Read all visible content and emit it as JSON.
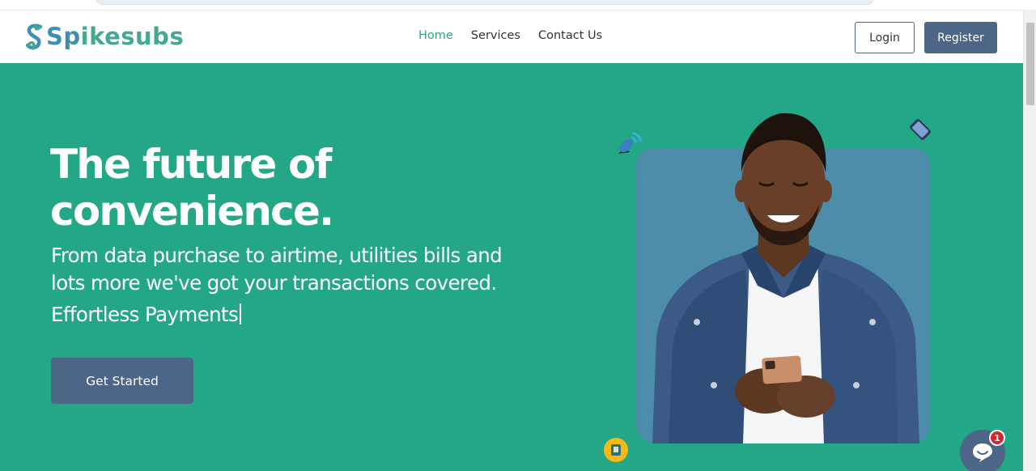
{
  "brand": {
    "name_part1": "Sp",
    "name_part2": "ikesubs",
    "primary_color": "#4d6587",
    "accent_color": "#24a786",
    "logo_icon": "spikesubs-logo-mark"
  },
  "nav": {
    "links": [
      {
        "label": "Home",
        "active": true
      },
      {
        "label": "Services",
        "active": false
      },
      {
        "label": "Contact Us",
        "active": false
      }
    ],
    "login_label": "Login",
    "register_label": "Register"
  },
  "hero": {
    "headline_line1": "The future of",
    "headline_line2": "convenience.",
    "subtext": "From data purchase to airtime, utilities bills and lots more we've got your transactions covered.",
    "typed_text": "Effortless Payments",
    "cta_label": "Get Started",
    "image_alt": "smiling man in denim jacket using phone",
    "floating_icons": [
      "satellite-dish-icon",
      "phone-icon",
      "sim-card-icon"
    ]
  },
  "chat": {
    "icon": "chat-bubble-icon",
    "unread_count": "1"
  }
}
